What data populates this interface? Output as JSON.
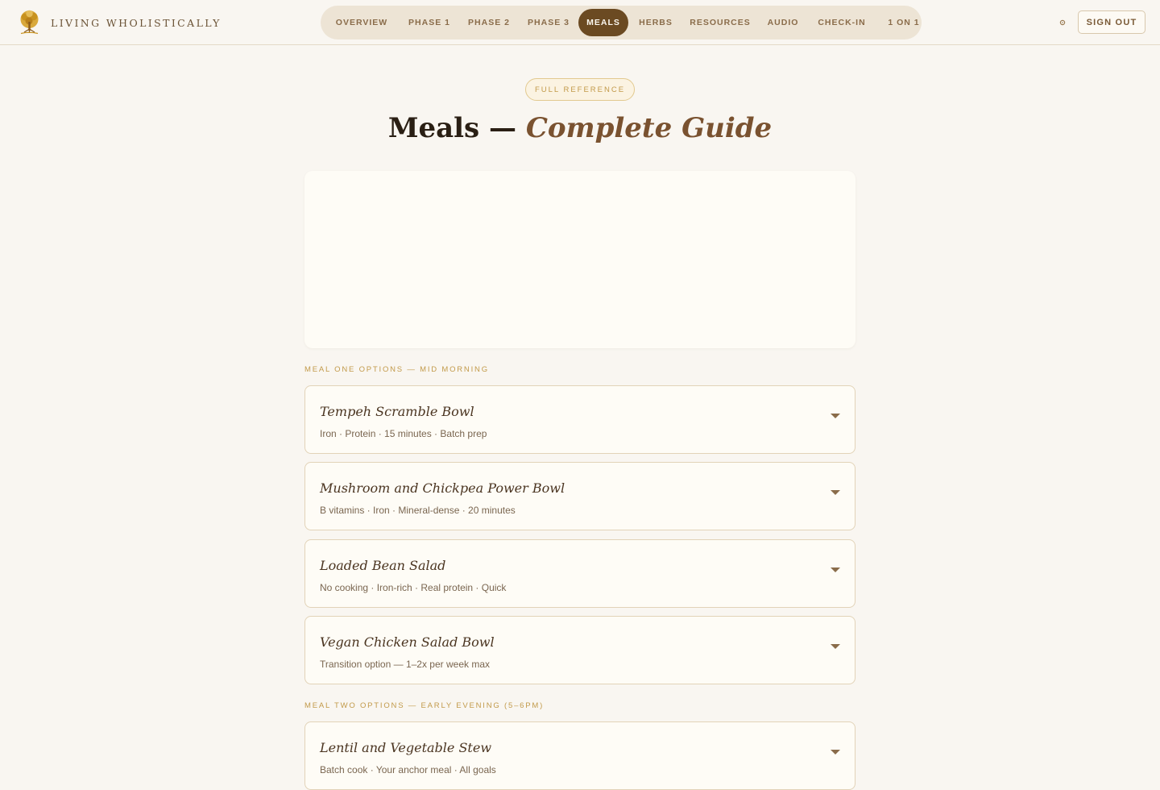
{
  "brand": {
    "name": "LIVING WHOLISTICALLY",
    "logo_icon": "tree-logo-icon"
  },
  "nav": {
    "items": [
      {
        "label": "OVERVIEW",
        "active": false
      },
      {
        "label": "PHASE 1",
        "active": false
      },
      {
        "label": "PHASE 2",
        "active": false
      },
      {
        "label": "PHASE 3",
        "active": false
      },
      {
        "label": "MEALS",
        "active": true
      },
      {
        "label": "HERBS",
        "active": false
      },
      {
        "label": "RESOURCES",
        "active": false
      },
      {
        "label": "AUDIO",
        "active": false
      },
      {
        "label": "CHECK-IN",
        "active": false
      },
      {
        "label": "1 ON 1",
        "active": false
      }
    ],
    "settings_icon": "gear-icon",
    "signout_label": "SIGN OUT"
  },
  "header": {
    "badge": "FULL REFERENCE",
    "title_main": "Meals —",
    "title_accent": "Complete Guide"
  },
  "sections": [
    {
      "label": "MEAL ONE OPTIONS — MID MORNING",
      "meals": [
        {
          "name": "Tempeh Scramble Bowl",
          "tags": "Iron · Protein · 15 minutes · Batch prep"
        },
        {
          "name": "Mushroom and Chickpea Power Bowl",
          "tags": "B vitamins · Iron · Mineral-dense · 20 minutes"
        },
        {
          "name": "Loaded Bean Salad",
          "tags": "No cooking · Iron-rich · Real protein · Quick"
        },
        {
          "name": "Vegan Chicken Salad Bowl",
          "tags": "Transition option — 1–2x per week max"
        }
      ]
    },
    {
      "label": "MEAL TWO OPTIONS — EARLY EVENING (5–6PM)",
      "meals": [
        {
          "name": "Lentil and Vegetable Stew",
          "tags": "Batch cook · Your anchor meal · All goals"
        }
      ]
    }
  ],
  "colors": {
    "background": "#f9f6f1",
    "accent_brown": "#6b4a22",
    "gold": "#c29a4a",
    "card": "#fefcf6"
  }
}
